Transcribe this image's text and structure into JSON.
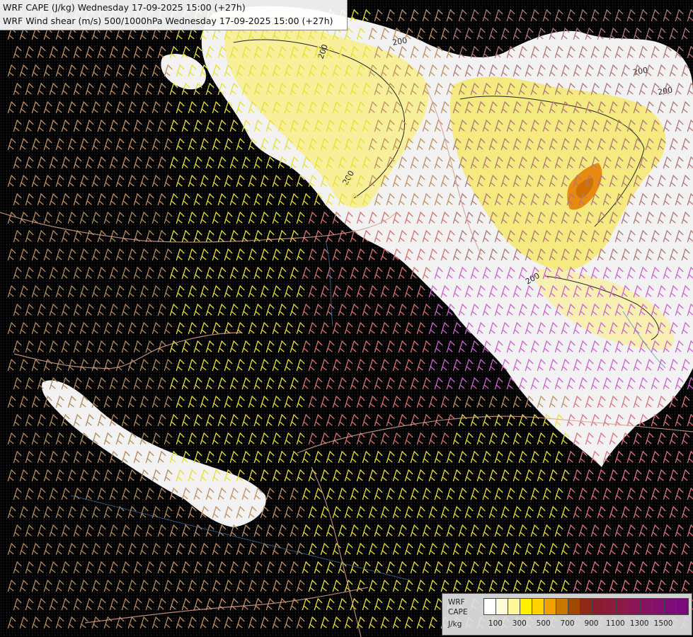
{
  "header": {
    "line1": "WRF CAPE (J/kg) Wednesday 17-09-2025 15:00 (+27h)",
    "line2": "WRF Wind shear (m/s) 500/1000hPa Wednesday 17-09-2025 15:00 (+27h)"
  },
  "legend": {
    "label1": "WRF",
    "label2": "CAPE",
    "label3": "J/kg",
    "colors": [
      "#ffffff",
      "#fffbd8",
      "#fff59a",
      "#fff000",
      "#ffd200",
      "#f0a000",
      "#c87800",
      "#a04800",
      "#902818",
      "#8a1e30",
      "#8c1c3c",
      "#8c1a48",
      "#8a1656",
      "#861262",
      "#82106c",
      "#7e0c76",
      "#7a0a7c"
    ],
    "ticks": [
      "100",
      "300",
      "500",
      "700",
      "900",
      "1100",
      "1300",
      "1500"
    ]
  },
  "map_contour_labels": [
    "200",
    "200",
    "200",
    "200",
    "200",
    "200",
    "200"
  ]
}
